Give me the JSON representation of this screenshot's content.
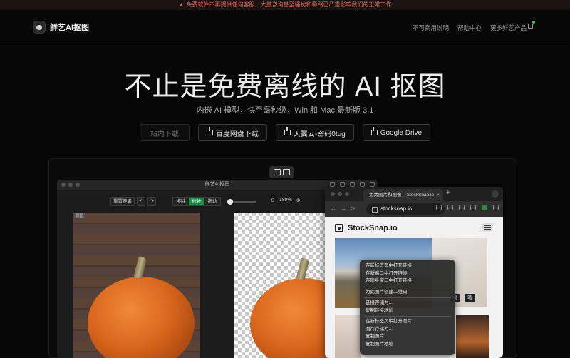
{
  "banner": {
    "text": "免费软件不再提供任何客服，大量咨询甚至骚扰和辱骂已严重影响我们的正常工作"
  },
  "nav": {
    "logo_text": "鲜艺AI抠图",
    "links": [
      "不可商用说明",
      "帮助中心",
      "更多鲜艺产品"
    ]
  },
  "hero": {
    "title": "不止是免费离线的 AI 抠图",
    "subtitle": "内嵌 AI 模型，快至毫秒级，Win 和 Mac 最新版 3.1",
    "buttons": {
      "onsite": "站内下载",
      "baidu": "百度网盘下载",
      "tianyi": "天翼云-密码0tug",
      "gdrive": "Google Drive"
    }
  },
  "app": {
    "title": "鲜艺AI抠图",
    "reset": "重置链果",
    "modes": [
      "擦除",
      "修补",
      "拖动"
    ],
    "zoom": "189%",
    "pane_tag": "原图"
  },
  "browser": {
    "tab_title": "免费图片和图像 – StockSnap.io",
    "url": "stocksnap.io",
    "site_name": "StockSnap.io",
    "badges": [
      "赠",
      "笔"
    ]
  },
  "context_menu": {
    "group1": [
      "在新标签页中打开链接",
      "在新窗口中打开链接",
      "在隐身窗口中打开链接"
    ],
    "group2": [
      "为此图片创建二维码"
    ],
    "group3": [
      "链接存储为...",
      "复制链接地址"
    ],
    "group4": [
      "在新标签页中打开图片",
      "图片存储为...",
      "复制图片",
      "复制图片地址"
    ]
  },
  "colors": {
    "accent_green": "#1e8a4a",
    "warning_red": "#e06a5c",
    "background": "#070707"
  }
}
